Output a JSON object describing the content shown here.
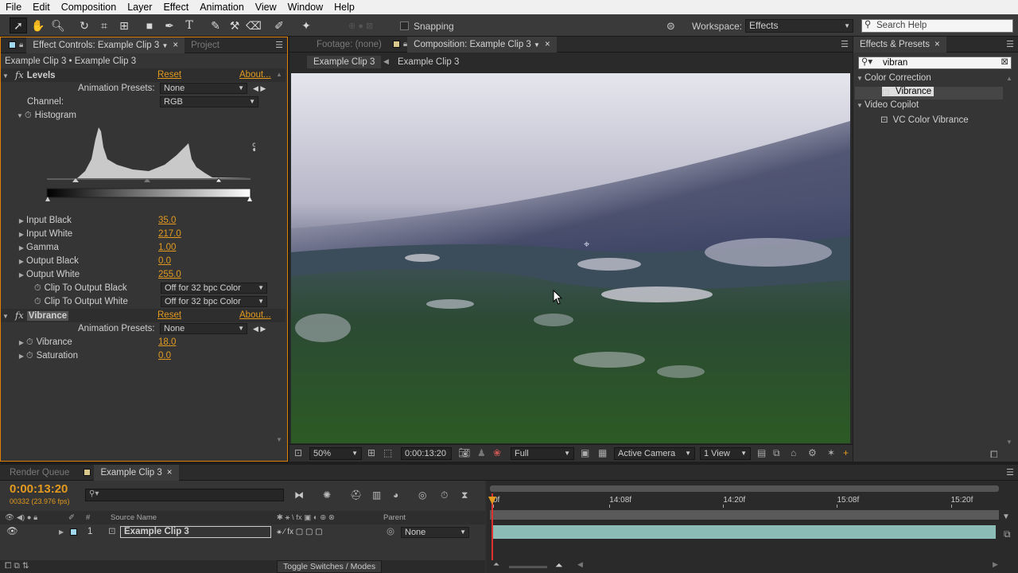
{
  "menu": [
    "File",
    "Edit",
    "Composition",
    "Layer",
    "Effect",
    "Animation",
    "View",
    "Window",
    "Help"
  ],
  "toolbar": {
    "snapping": "Snapping",
    "workspace_label": "Workspace:",
    "workspace_value": "Effects",
    "search_placeholder": "Search Help"
  },
  "effect_controls": {
    "tab": "Effect Controls: Example Clip 3",
    "project_tab": "Project",
    "breadcrumb": "Example Clip 3 • Example Clip 3",
    "levels": {
      "name": "Levels",
      "reset": "Reset",
      "about": "About...",
      "anim_presets_label": "Animation Presets:",
      "anim_presets_value": "None",
      "channel_label": "Channel:",
      "channel_value": "RGB",
      "histogram": "Histogram",
      "props": [
        {
          "label": "Input Black",
          "value": "35.0"
        },
        {
          "label": "Input White",
          "value": "217.0"
        },
        {
          "label": "Gamma",
          "value": "1.00"
        },
        {
          "label": "Output Black",
          "value": "0.0"
        },
        {
          "label": "Output White",
          "value": "255.0"
        }
      ],
      "clip_black_label": "Clip To Output Black",
      "clip_black_value": "Off for 32 bpc Color",
      "clip_white_label": "Clip To Output White",
      "clip_white_value": "Off for 32 bpc Color"
    },
    "vibrance": {
      "name": "Vibrance",
      "reset": "Reset",
      "about": "About...",
      "anim_presets_label": "Animation Presets:",
      "anim_presets_value": "None",
      "props": [
        {
          "label": "Vibrance",
          "value": "18.0"
        },
        {
          "label": "Saturation",
          "value": "0.0"
        }
      ]
    }
  },
  "composition": {
    "footage_tab": "Footage: (none)",
    "comp_tab": "Composition: Example Clip 3",
    "crumb1": "Example Clip 3",
    "crumb2": "Example Clip 3",
    "zoom": "50%",
    "timecode": "0:00:13:20",
    "resolution": "Full",
    "camera": "Active Camera",
    "views": "1 View"
  },
  "effects_presets": {
    "tab": "Effects & Presets",
    "search_value": "vibran",
    "categories": [
      {
        "name": "Color Correction",
        "item": "Vibrance"
      },
      {
        "name": "Video Copilot",
        "item": "VC Color Vibrance"
      }
    ]
  },
  "timeline": {
    "render_queue": "Render Queue",
    "comp_tab": "Example Clip 3",
    "timecode": "0:00:13:20",
    "frame_info": "00332 (23.976 fps)",
    "source_name_header": "Source Name",
    "parent_header": "Parent",
    "hash_header": "#",
    "layer_num": "1",
    "layer_name": "Example Clip 3",
    "parent_value": "None",
    "toggle": "Toggle Switches / Modes",
    "ruler": [
      {
        "label": "0f",
        "pos": 0.0
      },
      {
        "label": "14:08f",
        "pos": 0.23
      },
      {
        "label": "14:20f",
        "pos": 0.455
      },
      {
        "label": "15:08f",
        "pos": 0.68
      },
      {
        "label": "15:20f",
        "pos": 0.905
      }
    ]
  },
  "colors": {
    "accent": "#e39a1e",
    "panel": "#353535",
    "selection": "#e08000"
  }
}
